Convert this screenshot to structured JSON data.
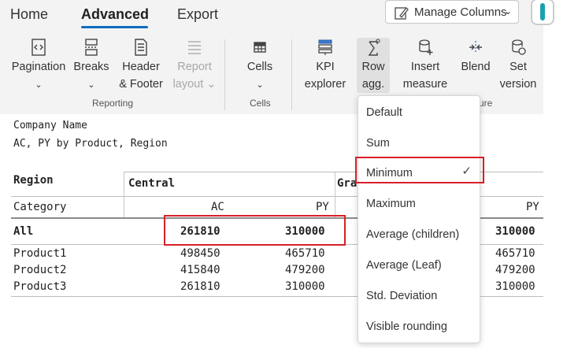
{
  "tabs": [
    "Home",
    "Advanced",
    "Export"
  ],
  "manage_columns": "Manage Columns",
  "ribbon": {
    "pagination": [
      "Pagination",
      "⌄"
    ],
    "breaks": [
      "Breaks",
      "⌄"
    ],
    "header_footer": [
      "Header",
      "& Footer"
    ],
    "report_layout": [
      "Report",
      "layout ⌄"
    ],
    "cells": [
      "Cells",
      "⌄"
    ],
    "kpi_explorer": [
      "KPI",
      "explorer"
    ],
    "row_agg": [
      "Row",
      "agg. ⌄"
    ],
    "insert_measure": [
      "Insert",
      "measure ⌄"
    ],
    "blend": [
      "Blend"
    ],
    "set_version": [
      "Set",
      "version"
    ],
    "group_reporting": "Reporting",
    "group_cells": "Cells",
    "group_partial": "ure"
  },
  "report": {
    "company": "Company Name",
    "subtitle": "AC, PY by Product, Region"
  },
  "table": {
    "region_label": "Region",
    "category_label": "Category",
    "central": "Central",
    "gr_partial": "Gra",
    "ac": "AC",
    "py": "PY",
    "rows": [
      {
        "name": "All",
        "ac": "261810",
        "py": "310000",
        "gpy": "310000"
      },
      {
        "name": "Product1",
        "ac": "498450",
        "py": "465710",
        "gpy": "465710"
      },
      {
        "name": "Product2",
        "ac": "415840",
        "py": "479200",
        "gpy": "479200"
      },
      {
        "name": "Product3",
        "ac": "261810",
        "py": "310000",
        "gpy": "310000"
      }
    ]
  },
  "dropdown": {
    "items": [
      "Default",
      "Sum",
      "Minimum",
      "Maximum",
      "Average (children)",
      "Average (Leaf)",
      "Std. Deviation",
      "Visible rounding"
    ],
    "selected": "Minimum",
    "check": "✓"
  },
  "colors": {
    "accent": "#0f6cbd",
    "highlight": "#d72027"
  }
}
